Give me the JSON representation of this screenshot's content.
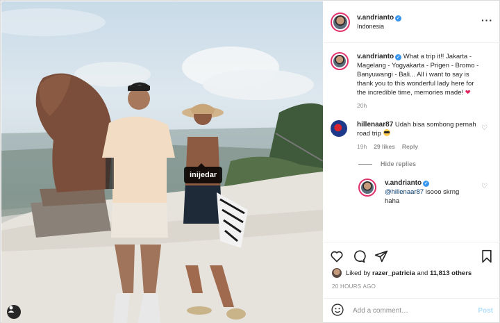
{
  "photo": {
    "tag_label": "inijedar",
    "user_tags_icon": "person-icon"
  },
  "header": {
    "username": "v.andrianto",
    "location": "Indonesia",
    "more_icon": "more-horizontal-icon"
  },
  "caption": {
    "username": "v.andrianto",
    "text": "What a trip it!! Jakarta - Magelang - Yogyakarta - Prigen - Bromo - Banyuwangi - Bali... All i want to say is thank you to this wonderful lady here for the incredible time, memories made!",
    "emoji": "❤",
    "time": "20h"
  },
  "comment1": {
    "username": "hillenaar87",
    "text": "Udah bisa sombong pernah road trip",
    "time": "19h",
    "likes": "29 likes",
    "reply_label": "Reply"
  },
  "hide_replies": "Hide replies",
  "reply1": {
    "username": "v.andrianto",
    "mention": "@hillenaar87",
    "text": " isooo skrng haha"
  },
  "likes": {
    "prefix": "Liked by ",
    "user": "razer_patricia",
    "middle": " and ",
    "count": "11,813 others"
  },
  "time_ago": "20 HOURS AGO",
  "add_comment": {
    "placeholder": "Add a comment…",
    "post_label": "Post"
  },
  "colors": {
    "verified": "#3897f0",
    "post_disabled": "#b2dffc",
    "like_heart": "#e0245e"
  }
}
